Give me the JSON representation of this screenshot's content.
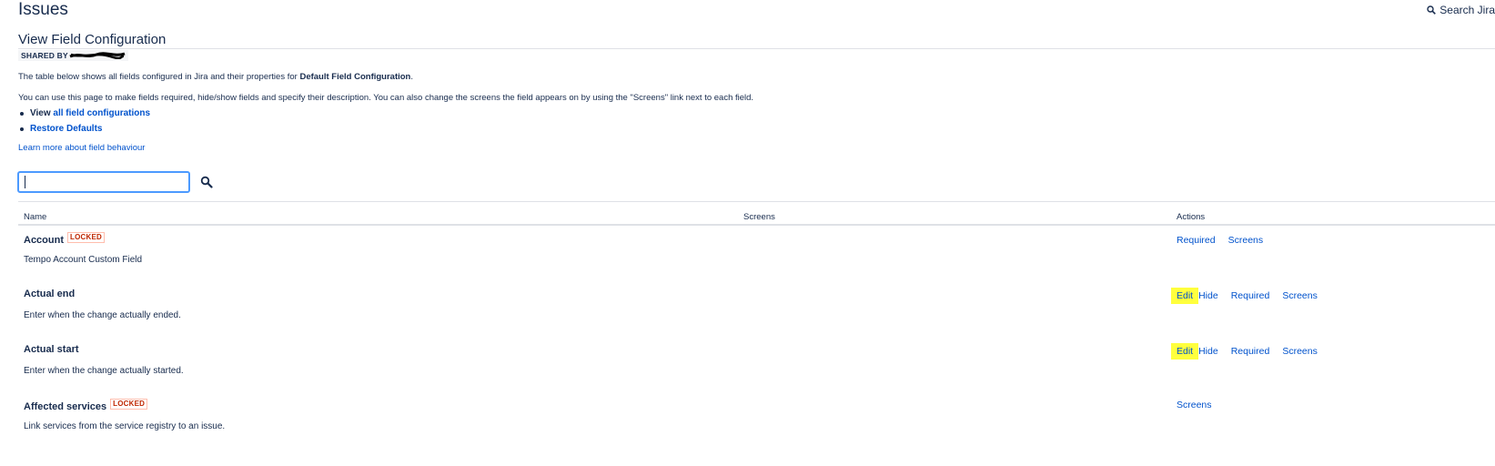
{
  "header": {
    "title": "Issues",
    "search_label": "Search Jira"
  },
  "config": {
    "title": "View Field Configuration",
    "shared_by": "SHARED BY",
    "intro_prefix": "The table below shows all fields configured in Jira and their properties for ",
    "intro_bold": "Default Field Configuration",
    "intro_suffix": ".",
    "intro2": "You can use this page to make fields required, hide/show fields and specify their description. You can also change the screens the field appears on by using the \"Screens\" link next to each field.",
    "view_prefix": "View ",
    "view_link": "all field configurations",
    "restore_link": "Restore Defaults",
    "learn_more": "Learn more about field behaviour"
  },
  "filter": {
    "value": ""
  },
  "table": {
    "headers": {
      "name": "Name",
      "screens": "Screens",
      "actions": "Actions"
    },
    "rows": [
      {
        "name": "Account",
        "locked": "LOCKED",
        "description": "Tempo Account Custom Field",
        "actions": [
          "Required",
          "Screens"
        ]
      },
      {
        "name": "Actual end",
        "description": "Enter when the change actually ended.",
        "actions": [
          "Edit",
          "Hide",
          "Required",
          "Screens"
        ]
      },
      {
        "name": "Actual start",
        "description": "Enter when the change actually started.",
        "actions": [
          "Edit",
          "Hide",
          "Required",
          "Screens"
        ]
      },
      {
        "name": "Affected services",
        "locked": "LOCKED",
        "description": "Link services from the service registry to an issue.",
        "actions": [
          "Screens"
        ]
      }
    ]
  },
  "colors": {
    "link": "#0052cc",
    "highlight": "#ffff3d",
    "text": "#172b4d",
    "locked": "#bf2600",
    "focus": "#4c9aff"
  },
  "icons": {
    "search": "search-icon"
  }
}
